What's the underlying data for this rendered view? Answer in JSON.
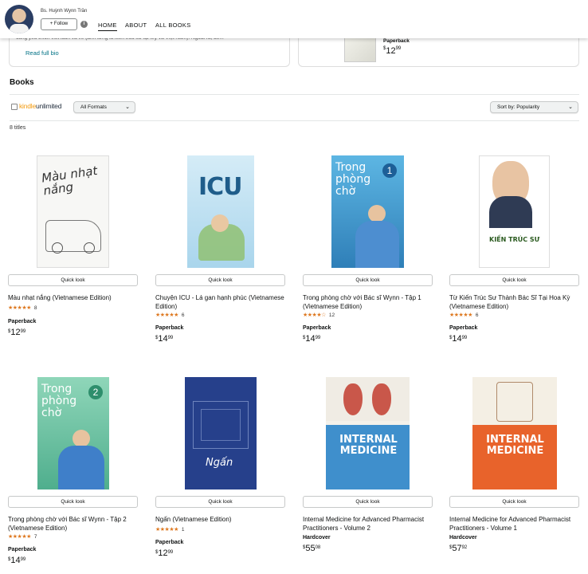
{
  "author": {
    "name": "Bs. Huỳnh Wynn Trần",
    "follow_label": "+ Follow",
    "info_icon": "info-icon"
  },
  "nav": {
    "home": "HOME",
    "about": "ABOUT",
    "all_books": "ALL BOOKS"
  },
  "bio": {
    "snippet": "cùng yêu thích viết lách và vẽ (ảnh từng là kiến trúc sư tại Mỹ và Việt Nam). Ngoài ra, để...",
    "read_more": "Read full bio"
  },
  "featured": {
    "format": "Paperback",
    "price": {
      "currency": "$",
      "whole": "12",
      "cents": "99"
    }
  },
  "books_section": {
    "title": "Books",
    "kindle_unlimited": {
      "part1": "kindle",
      "part2": "unlimited"
    },
    "format_filter": "All Formats",
    "sort_label": "Sort by: Popularity",
    "count": "8 titles"
  },
  "quick_look_label": "Quick look",
  "books": [
    {
      "title": "Màu nhạt nắng (Vietnamese Edition)",
      "stars": "★★★★★",
      "reviews": "8",
      "format": "Paperback",
      "price": {
        "currency": "$",
        "whole": "12",
        "cents": "99"
      },
      "cover_title": "Màu nhạt nắng",
      "cover_color": "#f4f4f4"
    },
    {
      "title": "Chuyện ICU - Lá gan hạnh phúc (Vietnamese Edition)",
      "stars": "★★★★★",
      "reviews": "6",
      "format": "Paperback",
      "price": {
        "currency": "$",
        "whole": "14",
        "cents": "99"
      },
      "cover_title": "ICU",
      "cover_color": "#c9e4f2"
    },
    {
      "title": "Trong phòng chờ với Bác sĩ Wynn - Tập 1 (Vietnamese Edition)",
      "stars": "★★★★☆",
      "reviews": "12",
      "format": "Paperback",
      "price": {
        "currency": "$",
        "whole": "14",
        "cents": "99"
      },
      "cover_title": "Trong phòng chờ",
      "cover_color": "#3a9fd4"
    },
    {
      "title": "Từ Kiến Trúc Sư Thành Bác Sĩ Tại Hoa Kỳ (Vietnamese Edition)",
      "stars": "★★★★★",
      "reviews": "6",
      "format": "Paperback",
      "price": {
        "currency": "$",
        "whole": "14",
        "cents": "99"
      },
      "cover_title": "KIẾN TRÚC SƯ",
      "cover_color": "#ffffff"
    },
    {
      "title": "Trong phòng chờ với Bác sĩ Wynn - Tập 2 (Vietnamese Edition)",
      "stars": "★★★★★",
      "reviews": "7",
      "format": "Paperback",
      "price": {
        "currency": "$",
        "whole": "14",
        "cents": "99"
      },
      "cover_title": "Trong phòng chờ",
      "cover_color": "#5cbf9a"
    },
    {
      "title": "Ngấn (Vietnamese Edition)",
      "stars": "★★★★★",
      "reviews": "1",
      "format": "Paperback",
      "price": {
        "currency": "$",
        "whole": "12",
        "cents": "99"
      },
      "cover_title": "Ngấn",
      "cover_color": "#26408b"
    },
    {
      "title": "Internal Medicine for Advanced Pharmacist Practitioners - Volume 2",
      "stars": "",
      "reviews": "",
      "format": "Hardcover",
      "price": {
        "currency": "$",
        "whole": "55",
        "cents": "08"
      },
      "cover_title": "INTERNAL MEDICINE",
      "cover_color": "#3f8fcc"
    },
    {
      "title": "Internal Medicine for Advanced Pharmacist Practitioners - Volume 1",
      "stars": "",
      "reviews": "",
      "format": "Hardcover",
      "price": {
        "currency": "$",
        "whole": "57",
        "cents": "92"
      },
      "cover_title": "INTERNAL MEDICINE",
      "cover_color": "#e8632b"
    }
  ]
}
